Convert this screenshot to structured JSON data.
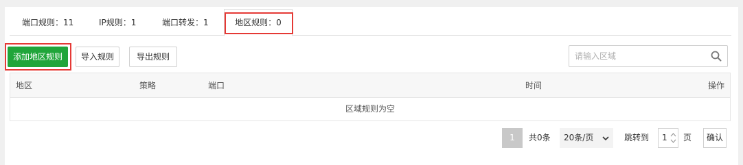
{
  "tabs": [
    {
      "label": "端口规则：11"
    },
    {
      "label": "IP规则：1"
    },
    {
      "label": "端口转发：1"
    },
    {
      "label": "地区规则：0"
    }
  ],
  "toolbar": {
    "add_label": "添加地区规则",
    "import_label": "导入规则",
    "export_label": "导出规则"
  },
  "search": {
    "placeholder": "请输入区域"
  },
  "table": {
    "columns": [
      "地区",
      "策略",
      "端口",
      "时间",
      "操作"
    ],
    "empty_text": "区域规则为空"
  },
  "pagination": {
    "current_page": "1",
    "total": "共0条",
    "page_size": "20条/页",
    "jump_label": "跳转到",
    "jump_value": "1",
    "page_unit": "页",
    "confirm_label": "确认"
  },
  "colors": {
    "primary": "#20a53a",
    "highlight": "#e53935"
  },
  "icons": [
    "search-icon",
    "chevron-down-icon",
    "spinner-arrows-icon"
  ]
}
